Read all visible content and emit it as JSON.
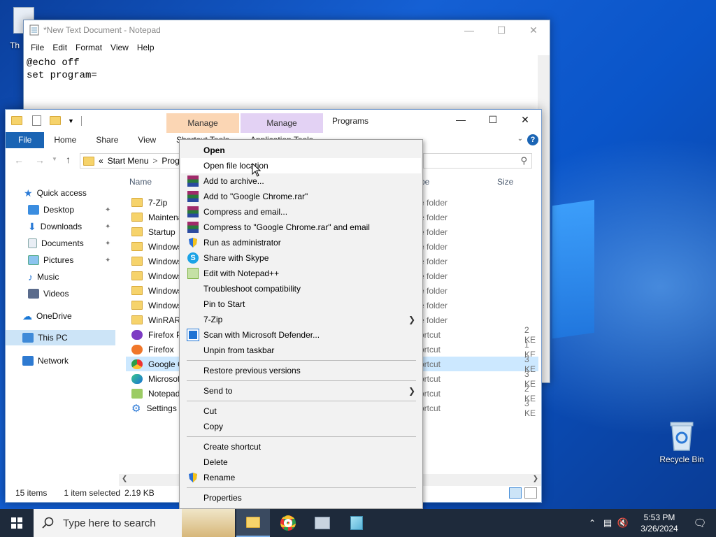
{
  "desktop": {
    "recycle_bin_label": "Recycle Bin",
    "partial_icon_label": "Th"
  },
  "notepad": {
    "title": "*New Text Document - Notepad",
    "menu": [
      "File",
      "Edit",
      "Format",
      "View",
      "Help"
    ],
    "lines": [
      "@echo off",
      "set program="
    ]
  },
  "explorer": {
    "title": "Programs",
    "context_tab_shortcut": "Manage",
    "context_tab_shortcut_sub": "Shortcut Tools",
    "context_tab_app": "Manage",
    "context_tab_app_sub": "Application Tools",
    "ribbon_tabs": [
      "File",
      "Home",
      "Share",
      "View"
    ],
    "address": {
      "prefix": "«",
      "crumb1": "Start Menu",
      "sep": ">",
      "crumb2": "Prog"
    },
    "columns": {
      "name": "Name",
      "type": "pe",
      "size": "Size"
    },
    "nav": {
      "quick_access": "Quick access",
      "desktop": "Desktop",
      "downloads": "Downloads",
      "documents": "Documents",
      "pictures": "Pictures",
      "music": "Music",
      "videos": "Videos",
      "onedrive": "OneDrive",
      "this_pc": "This PC",
      "network": "Network"
    },
    "files": [
      {
        "name": "7-Zip",
        "type": "e folder",
        "size": ""
      },
      {
        "name": "Maintena",
        "type": "e folder",
        "size": ""
      },
      {
        "name": "Startup",
        "type": "e folder",
        "size": ""
      },
      {
        "name": "Windows",
        "type": "e folder",
        "size": ""
      },
      {
        "name": "Windows",
        "type": "e folder",
        "size": ""
      },
      {
        "name": "Windows",
        "type": "e folder",
        "size": ""
      },
      {
        "name": "Windows",
        "type": "e folder",
        "size": ""
      },
      {
        "name": "Windows",
        "type": "e folder",
        "size": ""
      },
      {
        "name": "WinRAR",
        "type": "e folder",
        "size": ""
      },
      {
        "name": "Firefox Pr",
        "type": "ortcut",
        "size": "2 KE"
      },
      {
        "name": "Firefox",
        "type": "ortcut",
        "size": "1 KE"
      },
      {
        "name": "Google C",
        "type": "ortcut",
        "size": "3 KE"
      },
      {
        "name": "Microsoft",
        "type": "ortcut",
        "size": "3 KE"
      },
      {
        "name": "Notepad+",
        "type": "ortcut",
        "size": "2 KE"
      },
      {
        "name": "Settings",
        "type": "ortcut",
        "size": "3 KE"
      }
    ],
    "status": {
      "items": "15 items",
      "selected": "1 item selected",
      "size": "2.19 KB"
    }
  },
  "context_menu": {
    "open": "Open",
    "open_file_location": "Open file location",
    "add_to_archive": "Add to archive...",
    "add_to_rar": "Add to \"Google Chrome.rar\"",
    "compress_email": "Compress and email...",
    "compress_rar_email": "Compress to \"Google Chrome.rar\" and email",
    "run_as_admin": "Run as administrator",
    "share_skype": "Share with Skype",
    "edit_notepadpp": "Edit with Notepad++",
    "troubleshoot": "Troubleshoot compatibility",
    "pin_start": "Pin to Start",
    "seven_zip": "7-Zip",
    "scan_defender": "Scan with Microsoft Defender...",
    "unpin_taskbar": "Unpin from taskbar",
    "restore_versions": "Restore previous versions",
    "send_to": "Send to",
    "cut": "Cut",
    "copy": "Copy",
    "create_shortcut": "Create shortcut",
    "delete": "Delete",
    "rename": "Rename",
    "properties": "Properties"
  },
  "taskbar": {
    "search_placeholder": "Type here to search",
    "time": "5:53 PM",
    "date": "3/26/2024"
  }
}
